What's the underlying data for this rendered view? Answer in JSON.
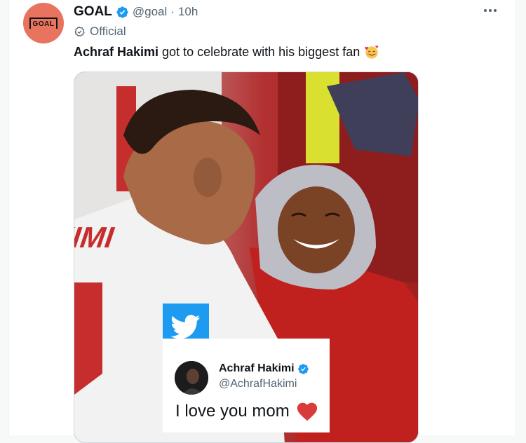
{
  "author": {
    "name": "GOAL",
    "handle": "@goal",
    "separator": "·",
    "time": "10h",
    "label": "Official",
    "avatar_text": "GOAL"
  },
  "tweet": {
    "bold_text": "Achraf Hakimi",
    "text": "got to celebrate with his biggest fan"
  },
  "embedded_card": {
    "name": "Achraf Hakimi",
    "handle": "@AchrafHakimi",
    "message": "I love you mom"
  },
  "photo": {
    "jersey_text": "KIMI"
  },
  "colors": {
    "verified": "#1d9bf0",
    "twitter_blue": "#1d9bf0",
    "goal_avatar": "#e8735f",
    "heart": "#d93a3a"
  }
}
